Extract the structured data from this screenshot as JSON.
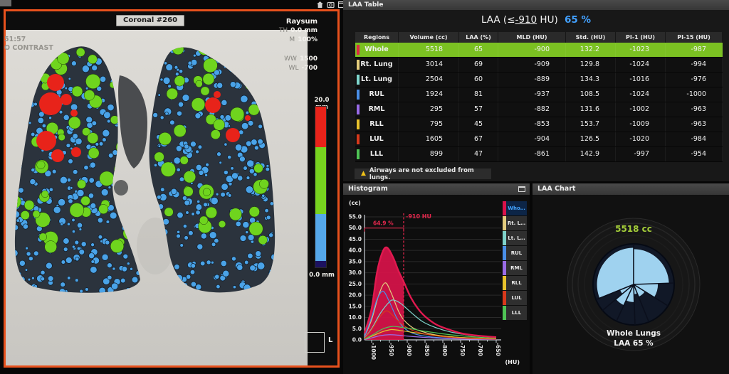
{
  "viewer": {
    "slice_label": "Coronal #260",
    "overlay_left": [
      "51:57",
      "O CONTRAST"
    ],
    "projection": "Raysum",
    "params": [
      {
        "label": "TH",
        "value": "0.0 mm"
      },
      {
        "label": "M",
        "value": "100%"
      },
      {
        "label": "WW",
        "value": "1500"
      },
      {
        "label": "WL",
        "value": "-700"
      }
    ],
    "color_scale": {
      "top": "20.0 mm",
      "bottom": "0.0 mm",
      "segments": [
        {
          "color": "#e8231a",
          "frac": 0.25
        },
        {
          "color": "#78d31f",
          "frac": 0.42
        },
        {
          "color": "#55a8ea",
          "frac": 0.29
        },
        {
          "color": "#1c1260",
          "frac": 0.04
        }
      ]
    },
    "orientation_marker": "L",
    "toolbar_icons": [
      "home-icon",
      "capture-icon",
      "window-icon"
    ]
  },
  "laa_table": {
    "panel_title": "LAA Table",
    "heading": {
      "pre": "LAA (≤",
      "threshold": "-910",
      "post": " HU)",
      "percent": "65 %"
    },
    "columns": [
      "Regions",
      "Volume (cc)",
      "LAA (%)",
      "MLD (HU)",
      "Std. (HU)",
      "PI-1 (HU)",
      "PI-15 (HU)"
    ],
    "rows": [
      {
        "region": "Whole Lungs",
        "chip": "#df2846",
        "highlight": true,
        "values": [
          "5518",
          "65",
          "-900",
          "132.2",
          "-1023",
          "-987"
        ]
      },
      {
        "region": "Rt. Lung",
        "chip": "#e5cd7d",
        "highlight": false,
        "values": [
          "3014",
          "69",
          "-909",
          "129.8",
          "-1024",
          "-994"
        ]
      },
      {
        "region": "Lt. Lung",
        "chip": "#7fd8cf",
        "highlight": false,
        "values": [
          "2504",
          "60",
          "-889",
          "134.3",
          "-1016",
          "-976"
        ]
      },
      {
        "region": "RUL",
        "chip": "#4a8fe8",
        "highlight": false,
        "values": [
          "1924",
          "81",
          "-937",
          "108.5",
          "-1024",
          "-1000"
        ]
      },
      {
        "region": "RML",
        "chip": "#9a6ce8",
        "highlight": false,
        "values": [
          "295",
          "57",
          "-882",
          "131.6",
          "-1002",
          "-963"
        ]
      },
      {
        "region": "RLL",
        "chip": "#e8c22c",
        "highlight": false,
        "values": [
          "795",
          "45",
          "-853",
          "153.7",
          "-1009",
          "-963"
        ]
      },
      {
        "region": "LUL",
        "chip": "#d8391c",
        "highlight": false,
        "values": [
          "1605",
          "67",
          "-904",
          "126.5",
          "-1020",
          "-984"
        ]
      },
      {
        "region": "LLL",
        "chip": "#4fc455",
        "highlight": false,
        "values": [
          "899",
          "47",
          "-861",
          "142.9",
          "-997",
          "-954"
        ]
      }
    ],
    "warning": "Airways are not excluded from lungs.",
    "highlight_color": "#7bc122",
    "accent_blue": "#42a0ff"
  },
  "chart_data": [
    {
      "type": "area",
      "title": "Histogram",
      "xlabel": "(HU)",
      "ylabel": "(cc)",
      "xlim": [
        -1020,
        -636
      ],
      "ylim": [
        0,
        55
      ],
      "x_ticks": [
        -1000,
        -950,
        -900,
        -850,
        -800,
        -750,
        -700,
        -650
      ],
      "y_ticks": [
        0,
        5,
        10,
        15,
        20,
        25,
        30,
        35,
        40,
        45,
        50,
        55
      ],
      "grid": true,
      "legend_position": "right",
      "threshold_hu": -910,
      "threshold_label": "-910 HU",
      "threshold_percent": "64.9 %",
      "annotation_color": "#e8274d",
      "series": [
        {
          "name": "Who…",
          "full_name": "Whole Lungs",
          "color": "#d8124a",
          "selected": true,
          "fill_to_threshold": true,
          "points": [
            [
              -1020,
              3
            ],
            [
              -1000,
              14
            ],
            [
              -985,
              30
            ],
            [
              -970,
              39
            ],
            [
              -957,
              41.3
            ],
            [
              -940,
              37
            ],
            [
              -925,
              31
            ],
            [
              -910,
              26
            ],
            [
              -890,
              19
            ],
            [
              -870,
              14
            ],
            [
              -850,
              10.5
            ],
            [
              -820,
              7
            ],
            [
              -790,
              5
            ],
            [
              -750,
              3
            ],
            [
              -710,
              2
            ],
            [
              -650,
              1.2
            ]
          ]
        },
        {
          "name": "Rt. L…",
          "full_name": "Rt. Lung",
          "color": "#e2cb7e",
          "selected": false,
          "points": [
            [
              -1020,
              1.5
            ],
            [
              -1000,
              9
            ],
            [
              -980,
              20
            ],
            [
              -962,
              25.5
            ],
            [
              -945,
              21
            ],
            [
              -925,
              13
            ],
            [
              -910,
              9
            ],
            [
              -885,
              5.5
            ],
            [
              -860,
              3.8
            ],
            [
              -820,
              2.2
            ],
            [
              -780,
              1.4
            ],
            [
              -720,
              0.8
            ],
            [
              -650,
              0.5
            ]
          ]
        },
        {
          "name": "Lt. L…",
          "full_name": "Lt. Lung",
          "color": "#7fd2ca",
          "selected": false,
          "points": [
            [
              -1020,
              0.8
            ],
            [
              -1000,
              5
            ],
            [
              -975,
              12
            ],
            [
              -950,
              17
            ],
            [
              -938,
              17.8
            ],
            [
              -920,
              16.5
            ],
            [
              -905,
              14.5
            ],
            [
              -880,
              11
            ],
            [
              -855,
              8
            ],
            [
              -820,
              5.5
            ],
            [
              -780,
              3.6
            ],
            [
              -730,
              2.2
            ],
            [
              -650,
              1.1
            ]
          ]
        },
        {
          "name": "RUL",
          "full_name": "RUL",
          "color": "#4a8fe8",
          "selected": false,
          "points": [
            [
              -1020,
              1.5
            ],
            [
              -1000,
              10
            ],
            [
              -985,
              18
            ],
            [
              -968,
              21.8
            ],
            [
              -950,
              17
            ],
            [
              -930,
              10
            ],
            [
              -910,
              5.5
            ],
            [
              -885,
              3
            ],
            [
              -855,
              1.8
            ],
            [
              -810,
              1
            ],
            [
              -750,
              0.5
            ],
            [
              -650,
              0.2
            ]
          ]
        },
        {
          "name": "RML",
          "full_name": "RML",
          "color": "#9a6ce8",
          "selected": false,
          "points": [
            [
              -1020,
              0.1
            ],
            [
              -1000,
              0.9
            ],
            [
              -975,
              1.9
            ],
            [
              -950,
              2.3
            ],
            [
              -925,
              2.1
            ],
            [
              -900,
              1.7
            ],
            [
              -870,
              1.3
            ],
            [
              -840,
              1
            ],
            [
              -790,
              0.6
            ],
            [
              -720,
              0.3
            ],
            [
              -650,
              0.2
            ]
          ]
        },
        {
          "name": "RLL",
          "full_name": "RLL",
          "color": "#e8c22c",
          "selected": false,
          "points": [
            [
              -1020,
              0.3
            ],
            [
              -1000,
              1.6
            ],
            [
              -970,
              3.6
            ],
            [
              -945,
              4.6
            ],
            [
              -920,
              4.2
            ],
            [
              -895,
              3.6
            ],
            [
              -865,
              2.9
            ],
            [
              -835,
              2.3
            ],
            [
              -790,
              1.6
            ],
            [
              -740,
              1
            ],
            [
              -650,
              0.5
            ]
          ]
        },
        {
          "name": "LUL",
          "full_name": "LUL",
          "color": "#d8391c",
          "selected": false,
          "points": [
            [
              -1020,
              0.6
            ],
            [
              -1000,
              4.5
            ],
            [
              -978,
              10
            ],
            [
              -958,
              13
            ],
            [
              -938,
              10.5
            ],
            [
              -915,
              7
            ],
            [
              -890,
              4.6
            ],
            [
              -860,
              3
            ],
            [
              -820,
              1.8
            ],
            [
              -770,
              1
            ],
            [
              -700,
              0.5
            ],
            [
              -650,
              0.3
            ]
          ]
        },
        {
          "name": "LLL",
          "full_name": "LLL",
          "color": "#4fc455",
          "selected": false,
          "points": [
            [
              -1020,
              0.3
            ],
            [
              -1000,
              2
            ],
            [
              -970,
              4.8
            ],
            [
              -942,
              6
            ],
            [
              -915,
              5.6
            ],
            [
              -890,
              5
            ],
            [
              -860,
              4.1
            ],
            [
              -830,
              3.4
            ],
            [
              -790,
              2.5
            ],
            [
              -740,
              1.7
            ],
            [
              -690,
              1.1
            ],
            [
              -650,
              0.8
            ]
          ]
        }
      ]
    },
    {
      "type": "pie",
      "variant": "rose",
      "title": "LAA Chart",
      "center_top_label": "5518 cc",
      "center_bottom_labels": [
        "Whole Lungs",
        "LAA 65 %"
      ],
      "top_label_color": "#a4ce39",
      "wedge_color": "#9fd2ef",
      "disc_color": "#111827",
      "wedges": [
        {
          "start": 0,
          "end": 88,
          "r": 0.8
        },
        {
          "start": 88,
          "end": 122,
          "r": 0.55
        },
        {
          "start": 122,
          "end": 158,
          "r": 0.3
        },
        {
          "start": 158,
          "end": 178,
          "r": 0.22
        },
        {
          "start": 178,
          "end": 205,
          "r": 0.4
        },
        {
          "start": 205,
          "end": 230,
          "r": 0.52
        },
        {
          "start": 230,
          "end": 248,
          "r": 0.33
        },
        {
          "start": 248,
          "end": 360,
          "r": 0.83
        }
      ]
    }
  ]
}
